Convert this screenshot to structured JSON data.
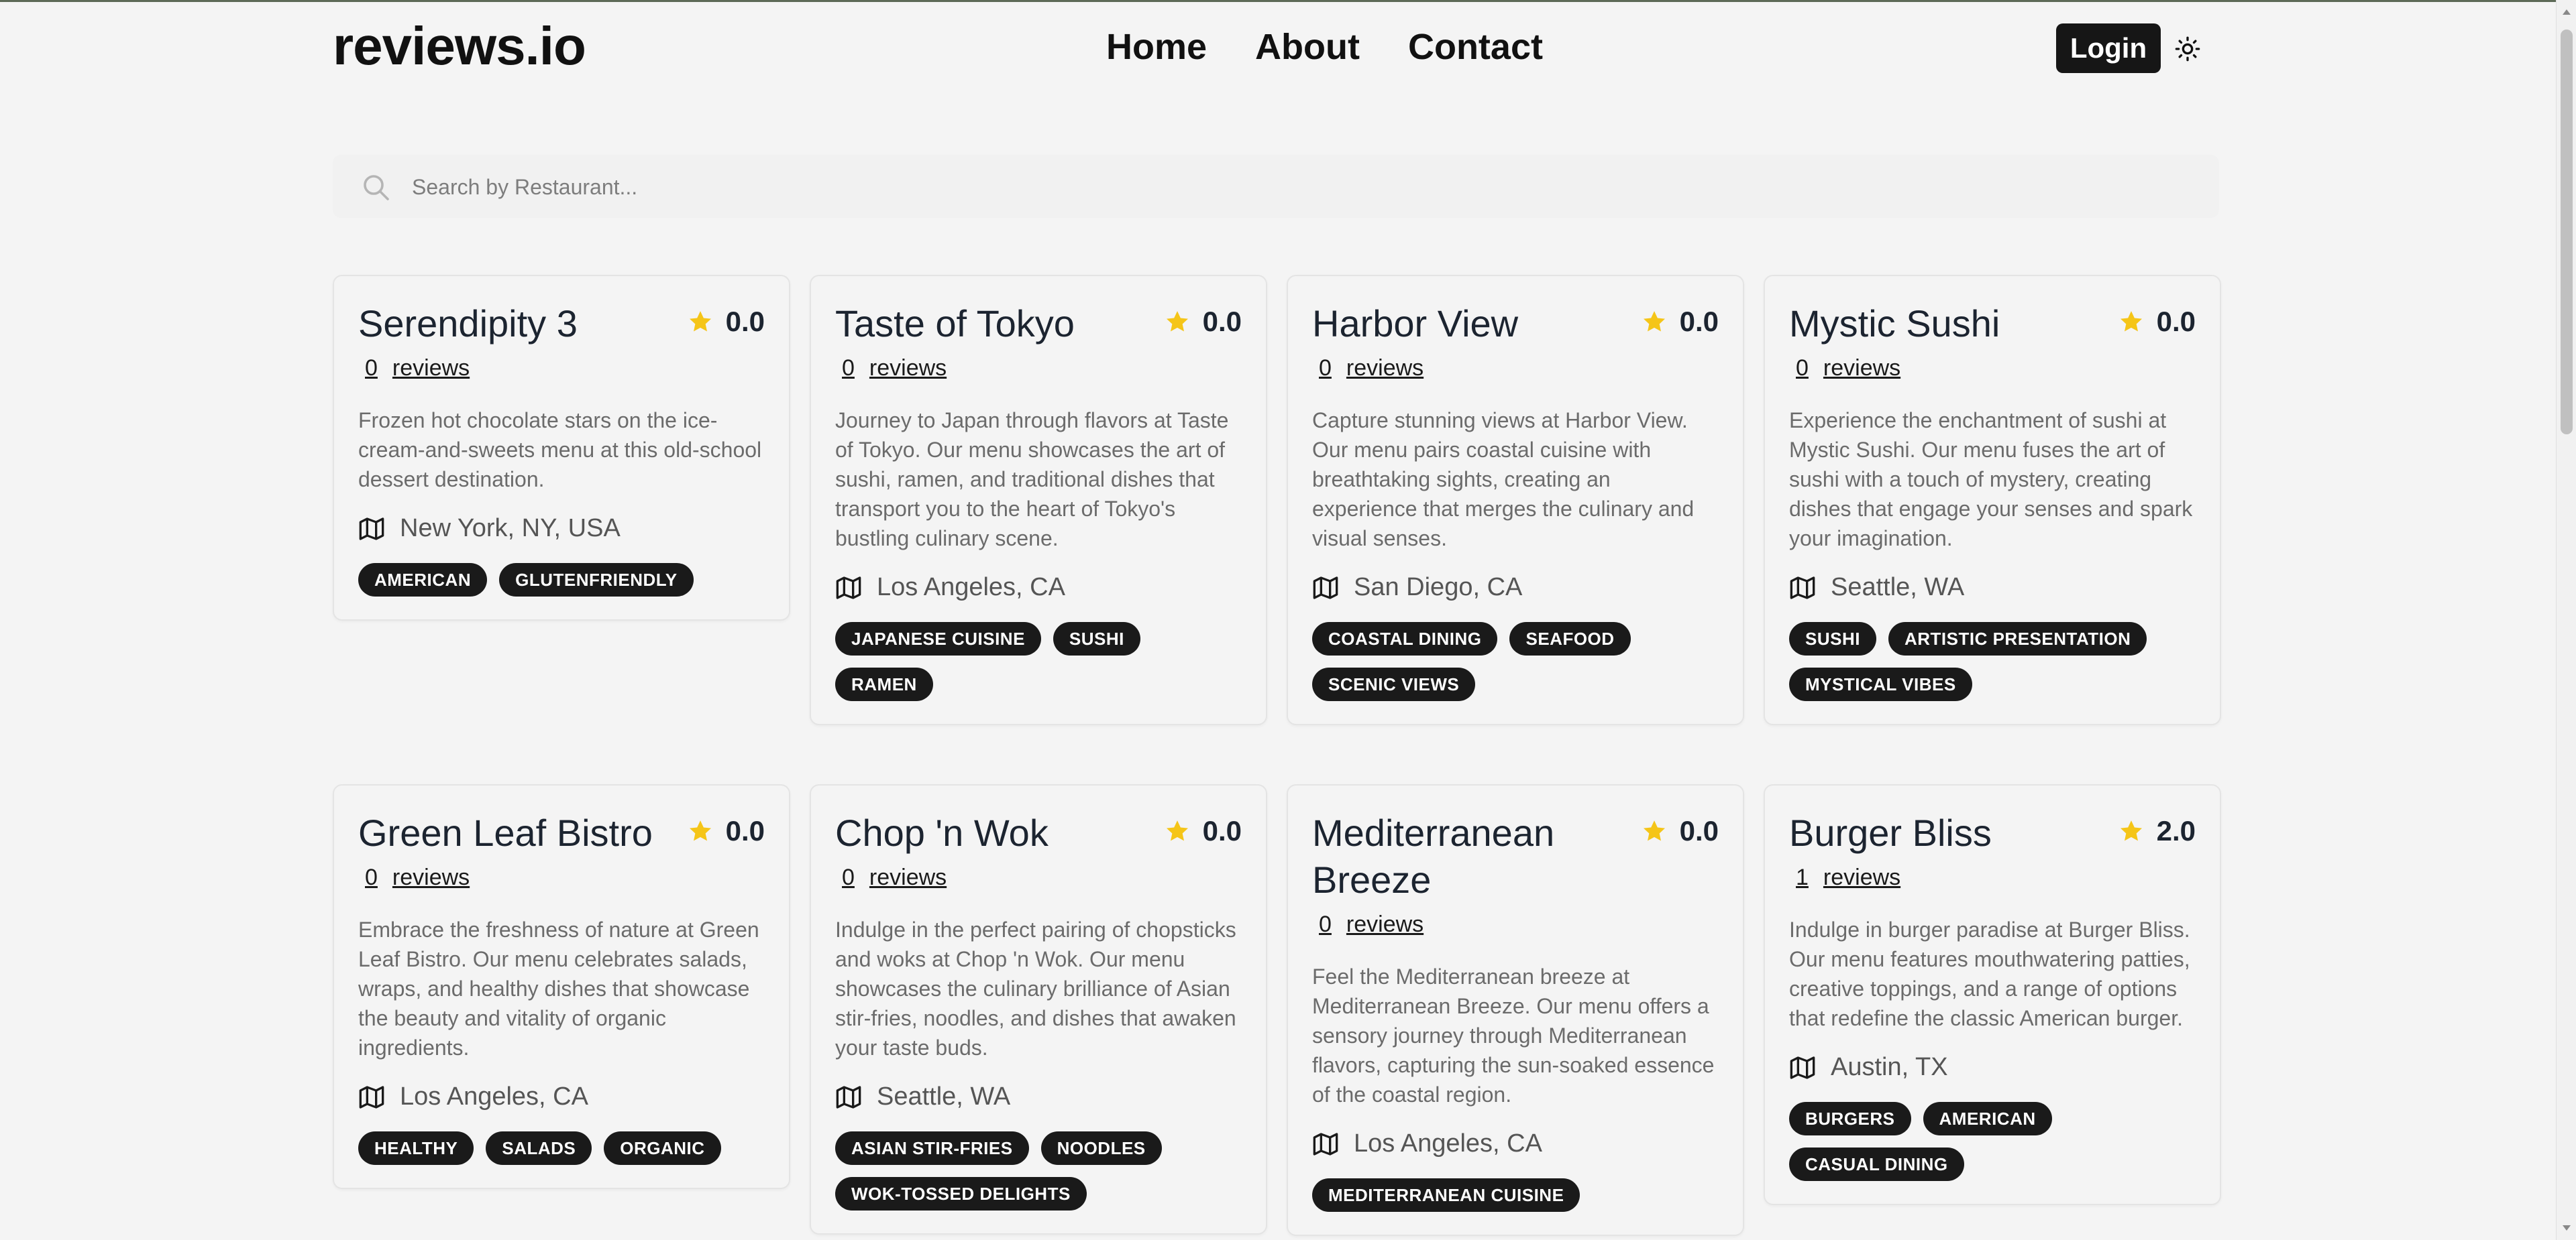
{
  "header": {
    "logo": "reviews.io",
    "nav": [
      "Home",
      "About",
      "Contact"
    ],
    "login_label": "Login",
    "theme_icon": "sun-icon"
  },
  "search": {
    "placeholder": "Search by Restaurant..."
  },
  "colors": {
    "star": "#f5c518",
    "tag_bg": "#1a1a1a",
    "button_bg": "#161616"
  },
  "restaurants": [
    {
      "name": "Serendipity 3",
      "rating": "0.0",
      "review_count": "0",
      "reviews_label": "reviews",
      "description": "Frozen hot chocolate stars on the ice-cream-and-sweets menu at this old-school dessert destination.",
      "location": "New York, NY, USA",
      "tags": [
        "AMERICAN",
        "GLUTENFRIENDLY"
      ]
    },
    {
      "name": "Taste of Tokyo",
      "rating": "0.0",
      "review_count": "0",
      "reviews_label": "reviews",
      "description": "Journey to Japan through flavors at Taste of Tokyo. Our menu showcases the art of sushi, ramen, and traditional dishes that transport you to the heart of Tokyo's bustling culinary scene.",
      "location": "Los Angeles, CA",
      "tags": [
        "JAPANESE CUISINE",
        "SUSHI",
        "RAMEN"
      ]
    },
    {
      "name": "Harbor View",
      "rating": "0.0",
      "review_count": "0",
      "reviews_label": "reviews",
      "description": "Capture stunning views at Harbor View. Our menu pairs coastal cuisine with breathtaking sights, creating an experience that merges the culinary and visual senses.",
      "location": "San Diego, CA",
      "tags": [
        "COASTAL DINING",
        "SEAFOOD",
        "SCENIC VIEWS"
      ]
    },
    {
      "name": "Mystic Sushi",
      "rating": "0.0",
      "review_count": "0",
      "reviews_label": "reviews",
      "description": "Experience the enchantment of sushi at Mystic Sushi. Our menu fuses the art of sushi with a touch of mystery, creating dishes that engage your senses and spark your imagination.",
      "location": "Seattle, WA",
      "tags": [
        "SUSHI",
        "ARTISTIC PRESENTATION",
        "MYSTICAL VIBES"
      ]
    },
    {
      "name": "Green Leaf Bistro",
      "rating": "0.0",
      "review_count": "0",
      "reviews_label": "reviews",
      "description": "Embrace the freshness of nature at Green Leaf Bistro. Our menu celebrates salads, wraps, and healthy dishes that showcase the beauty and vitality of organic ingredients.",
      "location": "Los Angeles, CA",
      "tags": [
        "HEALTHY",
        "SALADS",
        "ORGANIC"
      ]
    },
    {
      "name": "Chop 'n Wok",
      "rating": "0.0",
      "review_count": "0",
      "reviews_label": "reviews",
      "description": "Indulge in the perfect pairing of chopsticks and woks at Chop 'n Wok. Our menu showcases the culinary brilliance of Asian stir-fries, noodles, and dishes that awaken your taste buds.",
      "location": "Seattle, WA",
      "tags": [
        "ASIAN STIR-FRIES",
        "NOODLES",
        "WOK-TOSSED DELIGHTS"
      ]
    },
    {
      "name": "Mediterranean Breeze",
      "rating": "0.0",
      "review_count": "0",
      "reviews_label": "reviews",
      "description": "Feel the Mediterranean breeze at Mediterranean Breeze. Our menu offers a sensory journey through Mediterranean flavors, capturing the sun-soaked essence of the coastal region.",
      "location": "Los Angeles, CA",
      "tags": [
        "MEDITERRANEAN CUISINE"
      ]
    },
    {
      "name": "Burger Bliss",
      "rating": "2.0",
      "review_count": "1",
      "reviews_label": "reviews",
      "description": "Indulge in burger paradise at Burger Bliss. Our menu features mouthwatering patties, creative toppings, and a range of options that redefine the classic American burger.",
      "location": "Austin, TX",
      "tags": [
        "BURGERS",
        "AMERICAN",
        "CASUAL DINING"
      ]
    }
  ]
}
